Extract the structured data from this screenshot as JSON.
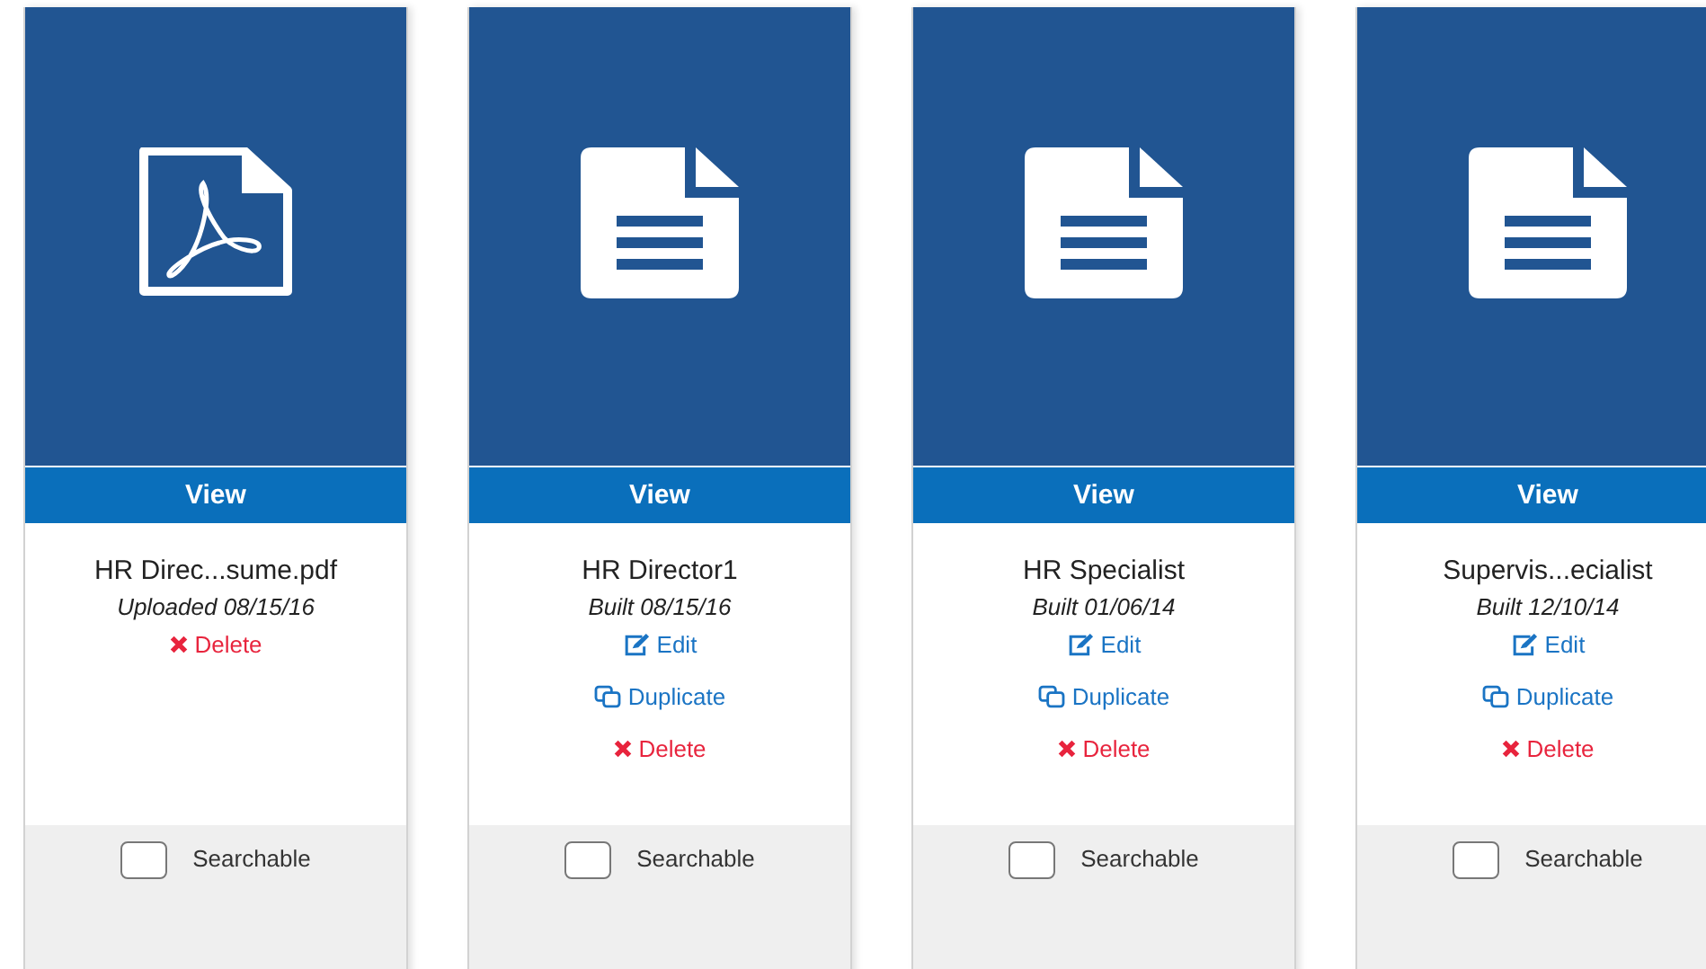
{
  "cards": [
    {
      "kind": "pdf",
      "view": "View",
      "title": "HR Direc...sume.pdf",
      "date": "Uploaded 08/15/16",
      "actions": [
        {
          "kind": "delete",
          "label": "Delete"
        }
      ],
      "searchable": {
        "label": "Searchable",
        "checked": false
      }
    },
    {
      "kind": "doc",
      "view": "View",
      "title": "HR Director1",
      "date": "Built 08/15/16",
      "actions": [
        {
          "kind": "edit",
          "label": "Edit"
        },
        {
          "kind": "duplicate",
          "label": "Duplicate"
        },
        {
          "kind": "delete",
          "label": "Delete"
        }
      ],
      "searchable": {
        "label": "Searchable",
        "checked": false
      }
    },
    {
      "kind": "doc",
      "view": "View",
      "title": "HR Specialist",
      "date": "Built 01/06/14",
      "actions": [
        {
          "kind": "edit",
          "label": "Edit"
        },
        {
          "kind": "duplicate",
          "label": "Duplicate"
        },
        {
          "kind": "delete",
          "label": "Delete"
        }
      ],
      "searchable": {
        "label": "Searchable",
        "checked": false
      }
    },
    {
      "kind": "doc",
      "view": "View",
      "title": "Supervis...ecialist",
      "date": "Built 12/10/14",
      "actions": [
        {
          "kind": "edit",
          "label": "Edit"
        },
        {
          "kind": "duplicate",
          "label": "Duplicate"
        },
        {
          "kind": "delete",
          "label": "Delete"
        }
      ],
      "searchable": {
        "label": "Searchable",
        "checked": false
      }
    }
  ]
}
